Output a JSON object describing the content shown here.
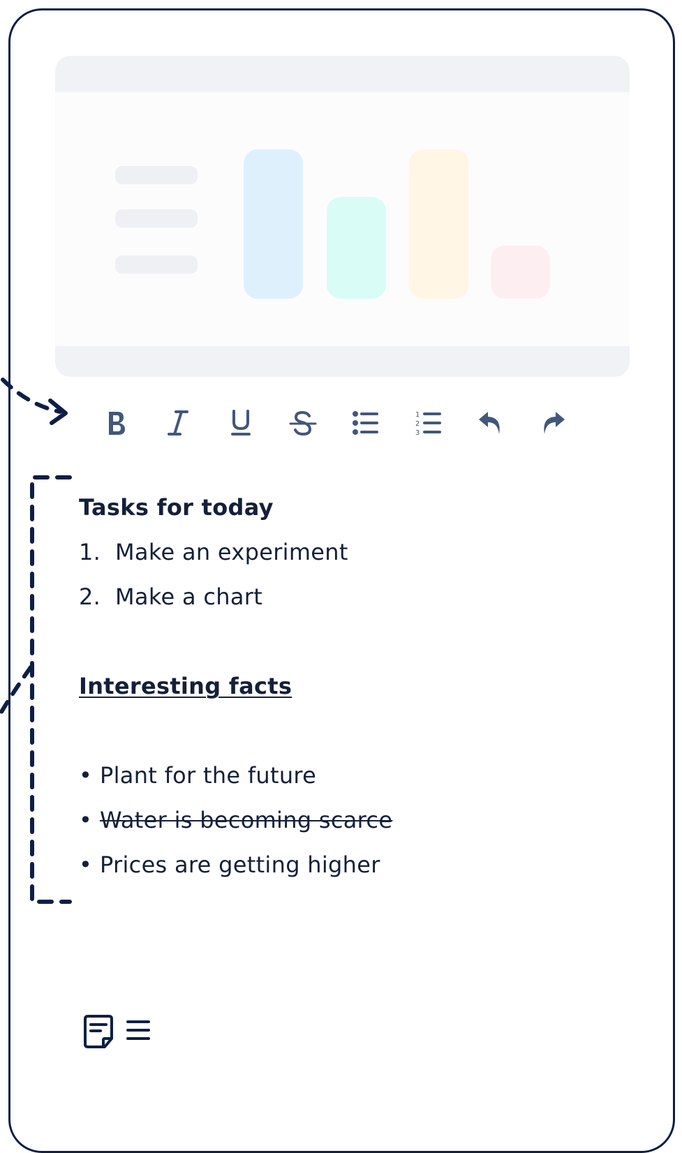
{
  "colors": {
    "frame": "#0d1f45",
    "icon": "#42577a",
    "text": "#14203a",
    "bar_blue": "#dff0fd",
    "bar_teal": "#d9fcf6",
    "bar_yellow": "#fff6e6",
    "bar_pink": "#fdeff1",
    "placeholder": "#eef0f4"
  },
  "toolbar": {
    "buttons": [
      {
        "name": "bold",
        "icon": "bold-icon"
      },
      {
        "name": "italic",
        "icon": "italic-icon"
      },
      {
        "name": "underline",
        "icon": "underline-icon"
      },
      {
        "name": "strikethrough",
        "icon": "strikethrough-icon"
      },
      {
        "name": "bullet-list",
        "icon": "bullet-list-icon"
      },
      {
        "name": "numbered-list",
        "icon": "numbered-list-icon"
      },
      {
        "name": "undo",
        "icon": "undo-icon"
      },
      {
        "name": "redo",
        "icon": "redo-icon"
      }
    ]
  },
  "editor": {
    "tasks_heading": "Tasks for today",
    "tasks": [
      {
        "num": "1.",
        "text": "Make an experiment"
      },
      {
        "num": "2.",
        "text": "Make a chart"
      }
    ],
    "facts_heading": "Interesting facts",
    "facts": [
      {
        "bullet": "•",
        "text": "Plant for the future",
        "strike": false
      },
      {
        "bullet": "•",
        "text": "Water is becoming scarce",
        "strike": true
      },
      {
        "bullet": "•",
        "text": "Prices are getting higher",
        "strike": false
      }
    ]
  },
  "footer": {
    "icons": [
      "note-icon",
      "menu-icon"
    ]
  }
}
